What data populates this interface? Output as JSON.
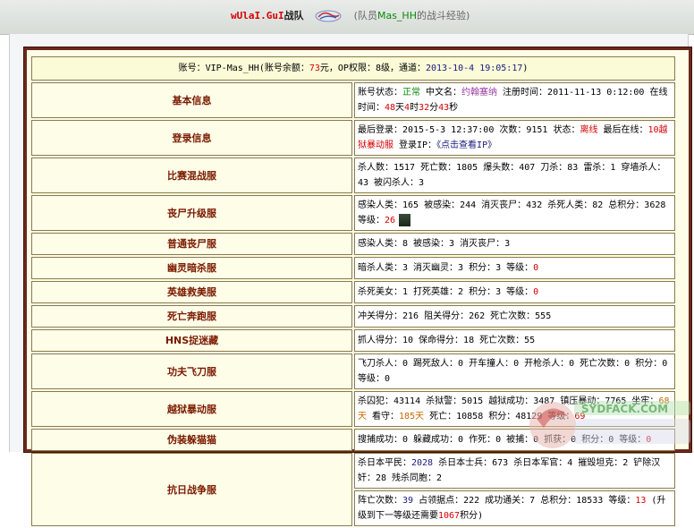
{
  "header": {
    "team_name": "wUlaI.GuI",
    "team_suffix": "战队",
    "note_open": "(队员",
    "member_name": "Mas_HH",
    "note_close": "的战斗经验)"
  },
  "account": {
    "p1": "账号：",
    "id": "VIP-Mas_HH",
    "p2": "(账号余额：",
    "balance": "73",
    "p3": "元，OP权限：",
    "op": "8",
    "p4": "级，通道：",
    "time": "2013-10-4 19:05:17",
    "p5": ")"
  },
  "rows": {
    "basic": {
      "label": "基本信息",
      "t1": "账号状态：",
      "status": "正常",
      "t2": " 中文名：",
      "cn_name": "约翰塞纳",
      "t3": " 注册时间：2011-11-13 0:12:00 在线时间：",
      "days": "48",
      "u_day": "天",
      "hours": "4",
      "u_hour": "时",
      "minutes": "32",
      "u_min": "分",
      "seconds": "43",
      "u_sec": "秒"
    },
    "login": {
      "label": "登录信息",
      "t1": "最后登录：2015-5-3 12:37:00 次数：9151 状态：",
      "status": "离线",
      "t2": " 最后在线：",
      "last_server": "10越狱暴动服",
      "t3": " 登录IP：",
      "ip_link": "《点击查看IP》"
    },
    "match": {
      "label": "比赛混战服",
      "text": "杀人数：1517 死亡数：1805 爆头数：407 刀杀：83 雷杀：1 穿墙杀人：43 被闪杀人：3"
    },
    "zombie_lvl": {
      "label": "丧尸升级服",
      "text": "感染人类：165 被感染：244 消灭丧尸：432 杀死人类：82 总积分：3628 等级：",
      "level": "26"
    },
    "zombie": {
      "label": "普通丧尸服",
      "text": "感染人类：8 被感染：3 消灭丧尸：3"
    },
    "ghost": {
      "label": "幽灵暗杀服",
      "text": "暗杀人类：3 消灭幽灵：3 积分：3 等级：",
      "level": "0"
    },
    "hero": {
      "label": "英雄救美服",
      "text": "杀死美女：1 打死英雄：2 积分：3 等级：",
      "level": "0"
    },
    "deathrun": {
      "label": "死亡奔跑服",
      "text": "冲关得分：216 阻关得分：262 死亡次数：555"
    },
    "hns": {
      "label": "HNS捉迷藏",
      "text": "抓人得分：10 保命得分：18 死亡次数：55"
    },
    "kungfu": {
      "label": "功夫飞刀服",
      "text": "飞刀杀人：0 踢死敌人：0 开车撞人：0 开枪杀人：0 死亡次数：0 积分：0 等级：0"
    },
    "jail": {
      "label": "越狱暴动服",
      "t1": "杀囚犯：43114 杀狱警：5015 越狱成功：3487 镇压暴动：7765 坐牢：",
      "jail_days": "68天",
      "t2": " 看守：",
      "guard_days": "185天",
      "t3": " 死亡：10858 积分：48129 等级：",
      "level": "69"
    },
    "hide": {
      "label": "伪装躲猫猫",
      "text": "搜捕成功：0 躲藏成功：0 作死：0 被捕：0 抓获：0 积分：0 等级：",
      "level": "0"
    },
    "war": {
      "label": "抗日战争服",
      "line1": {
        "t1": "杀日本平民：",
        "civilians": "2028",
        "t2": " 杀日本士兵：673 杀日本军官：4 摧毁坦克：2 铲除汉奸：28 残杀同胞：2"
      },
      "line2": {
        "t1": "阵亡次数：",
        "deaths": "39",
        "t2": " 占领据点：222 成功通关：7 总积分：18533 等级：",
        "level": "13",
        "t3": " (升级到下一等级还需要",
        "need": "1067",
        "t4": "积分)"
      }
    }
  },
  "watermark": {
    "text": "SYDFACK.COM"
  }
}
